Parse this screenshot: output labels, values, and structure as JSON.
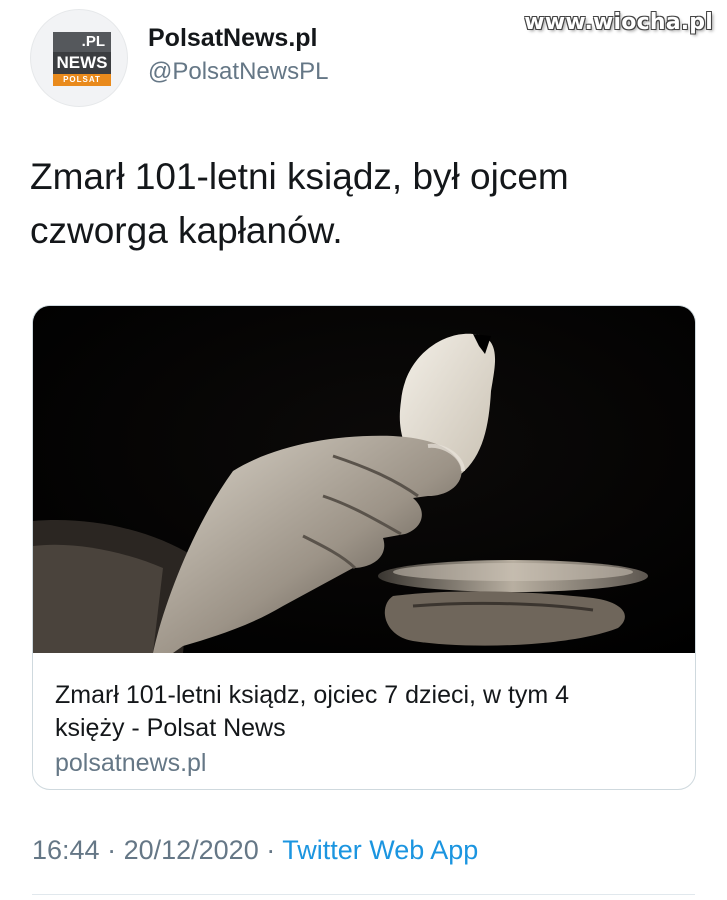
{
  "watermark": "www.wiocha.pl",
  "author": {
    "display_name": "PolsatNews.pl",
    "handle": "@PolsatNewsPL",
    "avatar_logo": {
      "top": ".PL",
      "middle": "NEWS",
      "bottom": "POLSAT"
    }
  },
  "tweet": {
    "text_line1": "Zmarł 101-letni ksiądz, był ojcem",
    "text_line2": "czworga kapłanów."
  },
  "card": {
    "image_icon": "communion-host-photo",
    "title_line1": "Zmarł 101-letni ksiądz, ojciec 7 dzieci, w tym 4",
    "title_line2": "księży - Polsat News",
    "domain": "polsatnews.pl"
  },
  "meta": {
    "time": "16:44",
    "sep1": " · ",
    "date": "20/12/2020",
    "sep2": " · ",
    "source": "Twitter Web App"
  },
  "colors": {
    "text": "#14171a",
    "secondary": "#657786",
    "link": "#1b95e0",
    "border": "#cfd9de",
    "logo_orange": "#e98a1c"
  }
}
